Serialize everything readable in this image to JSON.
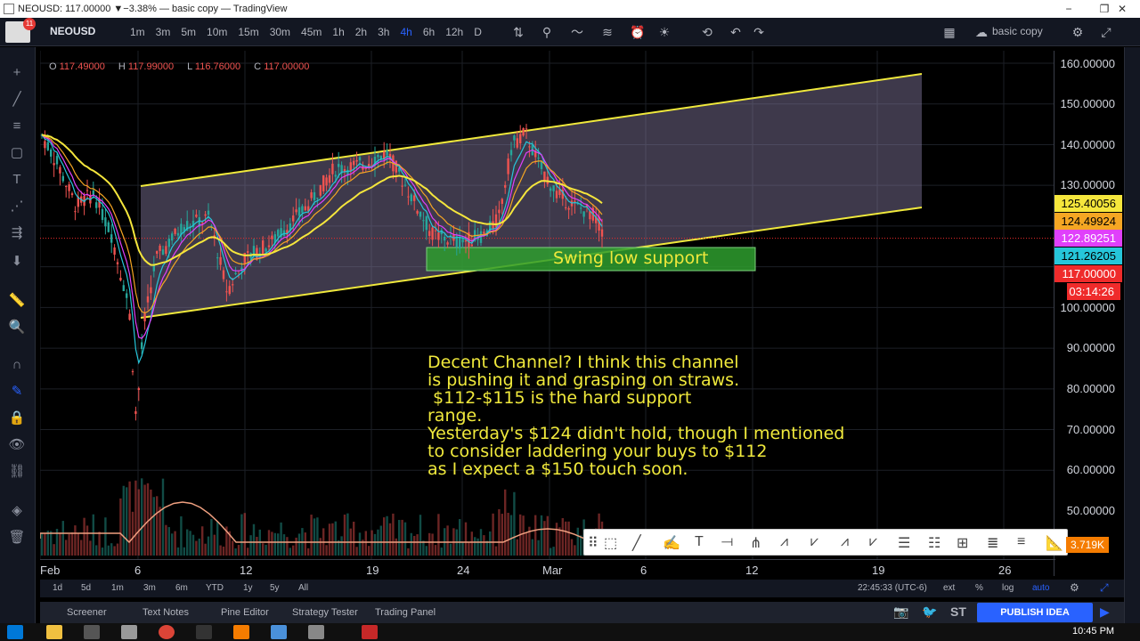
{
  "window": {
    "title": "NEOUSD: 117.00000 ▼−3.38% — basic copy — TradingView",
    "minimize": "−",
    "maximize": "❐",
    "close": "✕"
  },
  "toolbar": {
    "avatar_badge": "11",
    "symbol": "NEOUSD",
    "intervals": [
      "1m",
      "3m",
      "5m",
      "10m",
      "15m",
      "30m",
      "45m",
      "1h",
      "2h",
      "3h",
      "4h",
      "6h",
      "12h",
      "D"
    ],
    "active_interval": "4h",
    "layout_name": "basic copy",
    "icons": [
      "compare-icon",
      "indicators-icon",
      "line-style-icon",
      "templates-icon",
      "alert-icon",
      "idea-icon",
      "replay-icon",
      "undo-icon",
      "redo-icon",
      "layout-grid-icon",
      "cloud-icon",
      "settings-icon",
      "fullscreen-icon"
    ]
  },
  "left_tools": [
    "crosshair-icon",
    "trend-line-icon",
    "fib-icon",
    "shapes-icon",
    "text-icon",
    "pattern-icon",
    "prediction-icon",
    "arrow-down-icon",
    "measure-icon",
    "zoom-icon",
    "magnet-icon",
    "drawing-mode-icon",
    "lock-icon",
    "eye-icon",
    "link-icon",
    "layers-icon",
    "trash-icon"
  ],
  "ohlc": {
    "o_label": "O",
    "o": "117.49000",
    "h_label": "H",
    "h": "117.99000",
    "l_label": "L",
    "l": "116.76000",
    "c_label": "C",
    "c": "117.00000"
  },
  "price_axis": [
    "160.00000",
    "150.00000",
    "140.00000",
    "130.00000",
    "100.00000",
    "90.00000",
    "80.00000",
    "70.00000",
    "60.00000",
    "50.00000"
  ],
  "price_tags": [
    {
      "text": "125.40056",
      "color": "#f5e63c"
    },
    {
      "text": "124.49924",
      "color": "#f5a623"
    },
    {
      "text": "122.89251",
      "color": "#e040fb"
    },
    {
      "text": "121.26205",
      "color": "#26c6da"
    },
    {
      "text": "117.00000",
      "color": "#ef2b2b"
    },
    {
      "text": "03:14:26",
      "color": "#ef2b2b"
    }
  ],
  "time_axis": [
    "Feb",
    "6",
    "12",
    "19",
    "24",
    "Mar",
    "6",
    "12",
    "19",
    "26"
  ],
  "volume_tag": "3.719K",
  "swing_label": "Swing low support",
  "annotation": "Decent Channel? I think this channel\nis pushing it and grasping on straws.\n $112-$115 is the hard support\nrange.\nYesterday's $124 didn't hold, though I mentioned\nto consider laddering your buys to $112\nas I expect a $150 touch soon.",
  "range_bar": {
    "ranges": [
      "1d",
      "5d",
      "1m",
      "3m",
      "6m",
      "YTD",
      "1y",
      "5y",
      "All"
    ],
    "time": "22:45:33 (UTC-6)",
    "ext": "ext",
    "percent": "%",
    "log": "log",
    "auto": "auto"
  },
  "bottom_tabs": [
    "Screener",
    "Text Notes",
    "Pine Editor",
    "Strategy Tester",
    "Trading Panel"
  ],
  "publish_label": "PUBLISH IDEA",
  "taskbar": {
    "clock": "10:45 PM"
  },
  "colors": {
    "background": "#000000",
    "channel_line": "#f0e93c",
    "channel_fill": "#8a7fa6",
    "support_box": "#2e9d2e",
    "bull": "#26a69a",
    "bear": "#ef5350",
    "accent": "#2962ff"
  }
}
